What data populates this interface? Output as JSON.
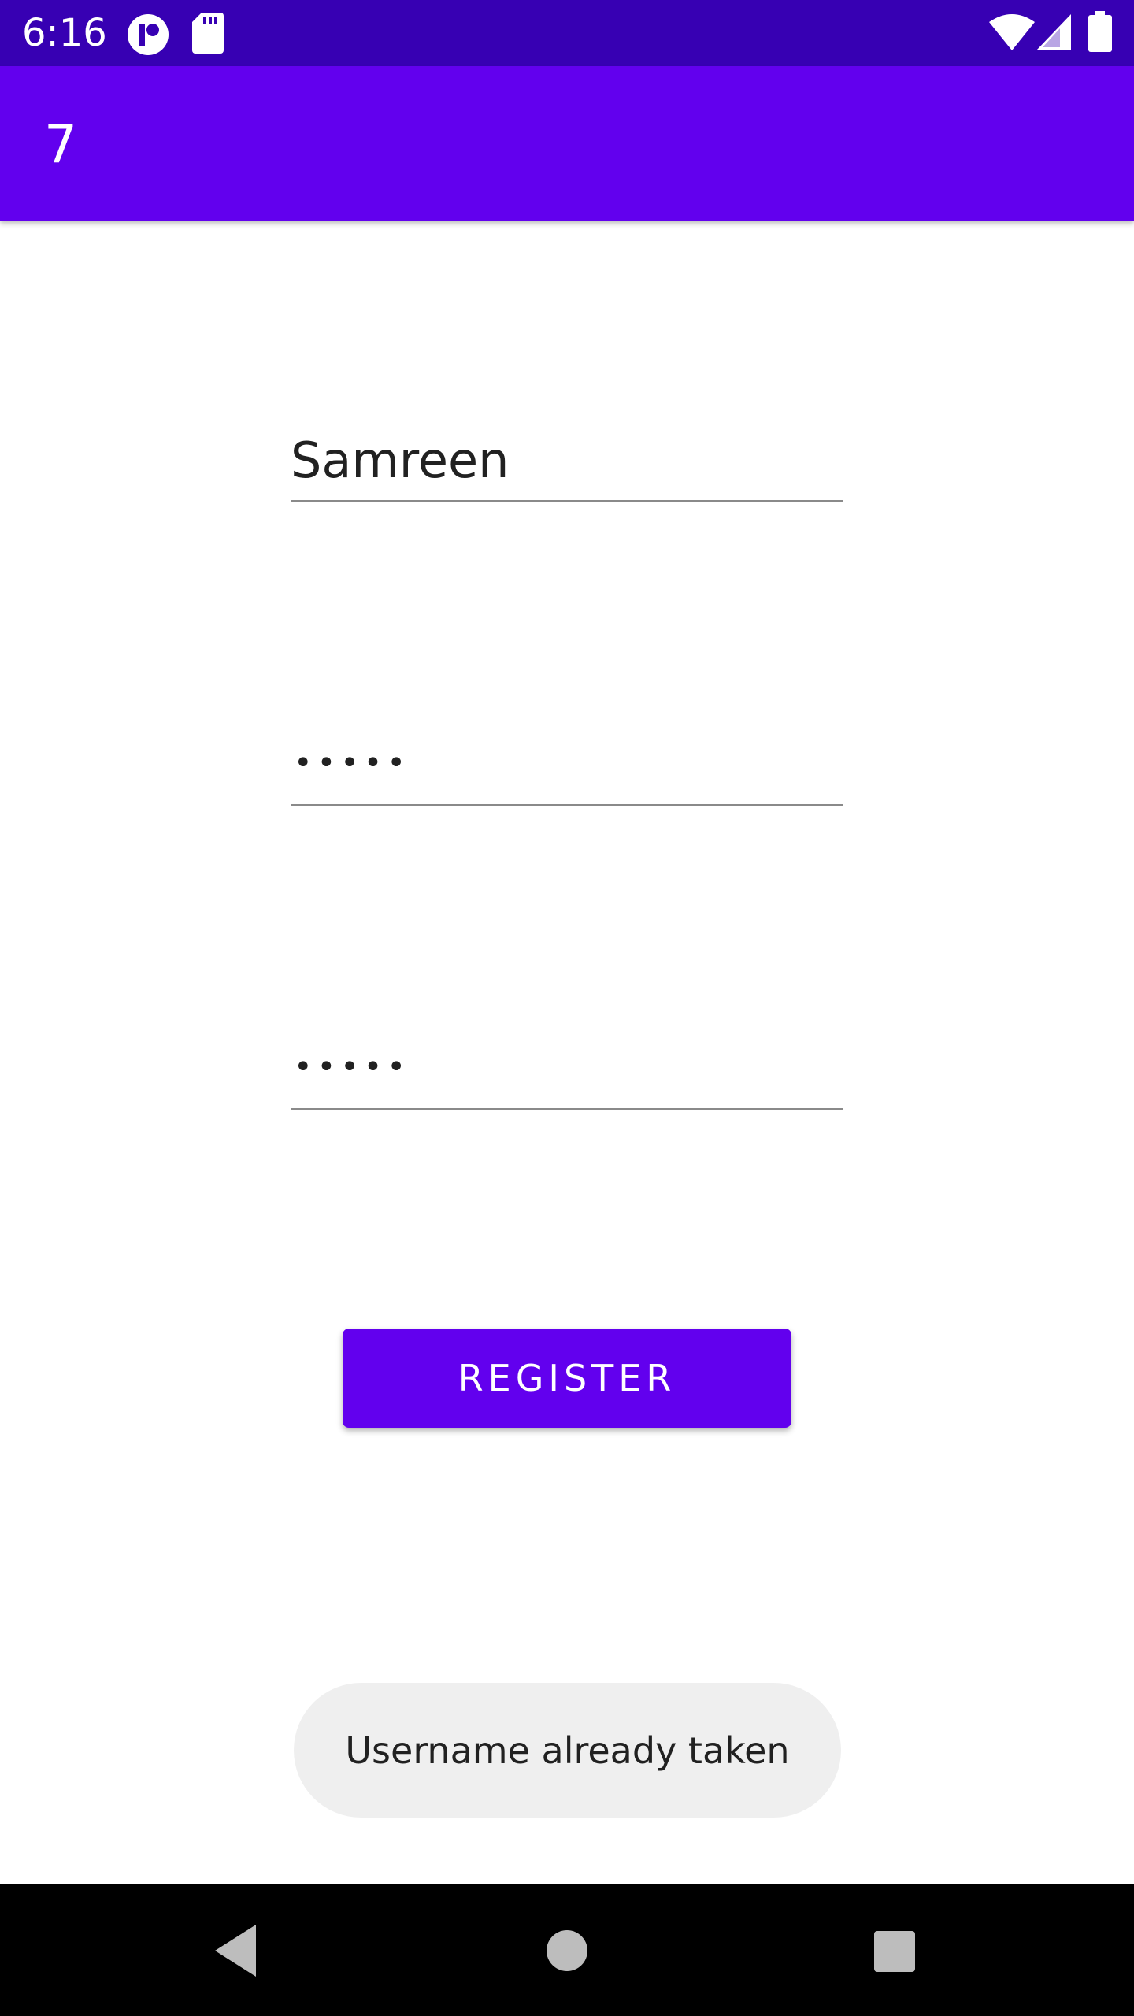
{
  "status_bar": {
    "time": "6:16",
    "background": "#3700b3",
    "icons": [
      "app-notification-icon",
      "sd-card-icon",
      "wifi-icon",
      "signal-icon",
      "battery-icon"
    ]
  },
  "app_bar": {
    "title": "7",
    "background": "#6200ee"
  },
  "form": {
    "username_value": "Samreen",
    "password_value": "•••••",
    "confirm_password_value": "•••••",
    "register_label": "REGISTER",
    "accent": "#6200ee"
  },
  "toast": {
    "message": "Username already taken"
  },
  "nav_bar": {
    "icons": [
      "back-icon",
      "home-icon",
      "recents-icon"
    ]
  }
}
